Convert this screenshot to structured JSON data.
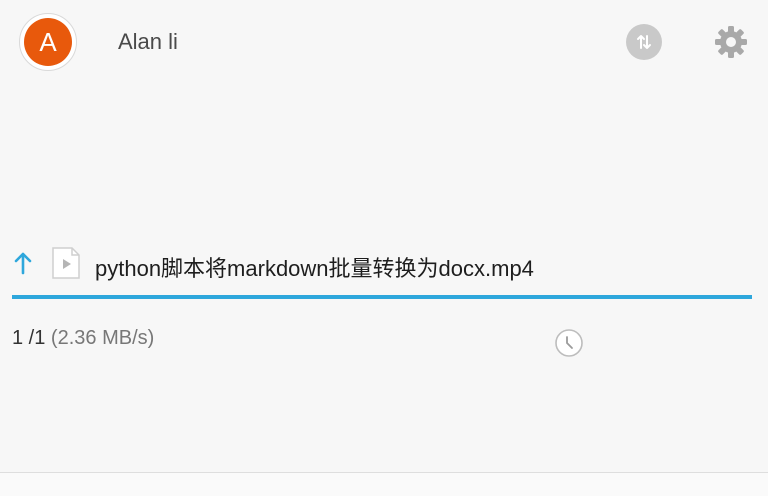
{
  "header": {
    "avatar_letter": "A",
    "avatar_color": "#e8590c",
    "username": "Alan li",
    "sync_icon": "sync-arrows-icon",
    "settings_icon": "gear-icon"
  },
  "upload": {
    "direction_icon": "upload-arrow-icon",
    "file_type_icon": "video-file-icon",
    "file_name": "python脚本将markdown批量转换为docx.mp4",
    "progress": 1.0,
    "progress_color": "#2ea7dc",
    "count": "1 /1",
    "speed": "(2.36 MB/s)",
    "status_icon": "clock-icon"
  }
}
